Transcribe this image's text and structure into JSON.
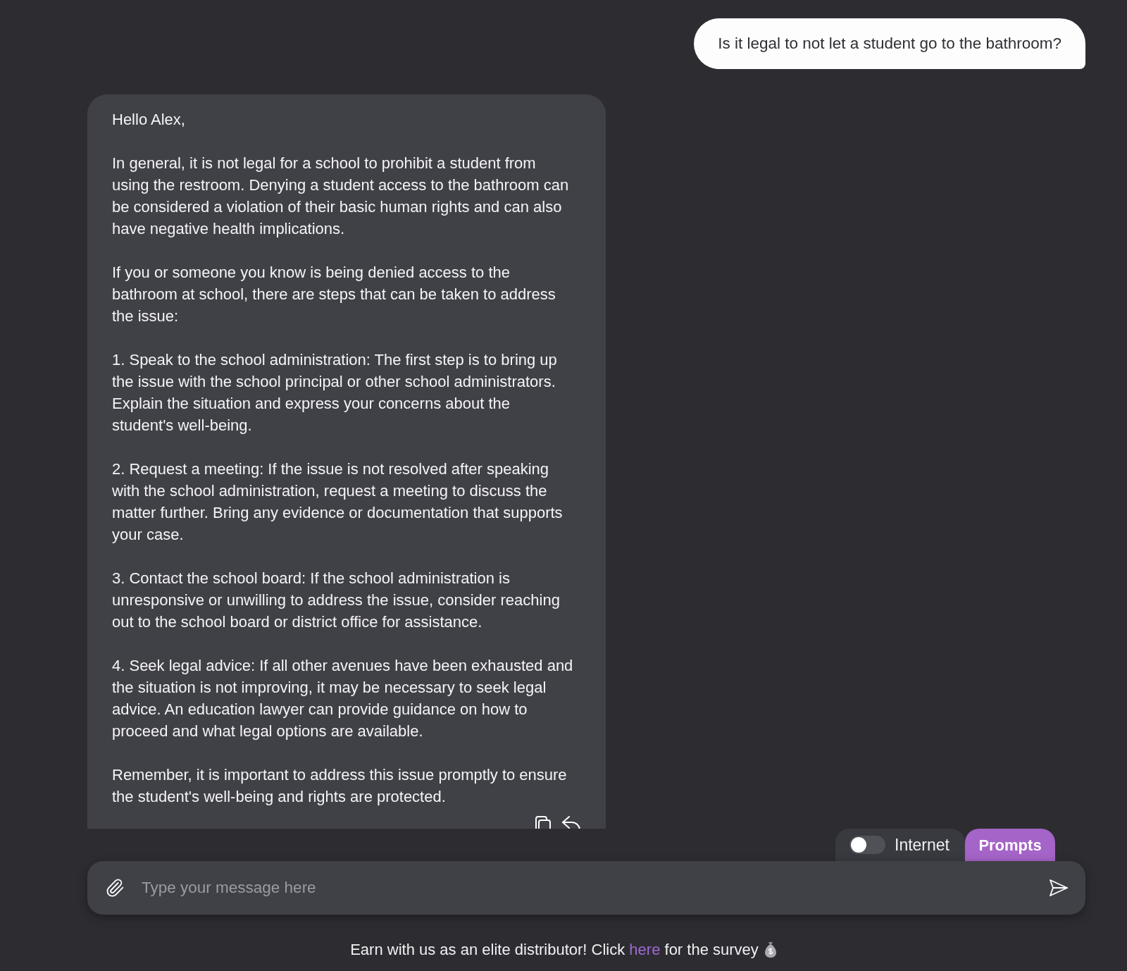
{
  "messages": [
    {
      "kind": "user",
      "text": "Is it legal to not let a student go to the bathroom?"
    },
    {
      "kind": "assistant",
      "paragraphs": [
        "Hello Alex,",
        "In general, it is not legal for a school to prohibit a student from using the restroom. Denying a student access to the bathroom can be considered a violation of their basic human rights and can also have negative health implications.",
        "If you or someone you know is being denied access to the bathroom at school, there are steps that can be taken to address the issue:",
        "1. Speak to the school administration: The first step is to bring up the issue with the school principal or other school administrators. Explain the situation and express your concerns about the student's well-being.",
        "2. Request a meeting: If the issue is not resolved after speaking with the school administration, request a meeting to discuss the matter further. Bring any evidence or documentation that supports your case.",
        "3. Contact the school board: If the school administration is unresponsive or unwilling to address the issue, consider reaching out to the school board or district office for assistance.",
        "4. Seek legal advice: If all other avenues have been exhausted and the situation is not improving, it may be necessary to seek legal advice. An education lawyer can provide guidance on how to proceed and what legal options are available.",
        "Remember, it is important to address this issue promptly to ensure the student's well-being and rights are protected."
      ]
    }
  ],
  "composer": {
    "internet_toggle": {
      "label": "Internet",
      "on": false
    },
    "prompts_button": {
      "label": "Prompts"
    },
    "message_input": {
      "placeholder": "Type your message here"
    }
  },
  "footer": {
    "text_before": "Earn with us as an elite distributor! Click ",
    "link": "here",
    "text_after": " for the survey"
  }
}
